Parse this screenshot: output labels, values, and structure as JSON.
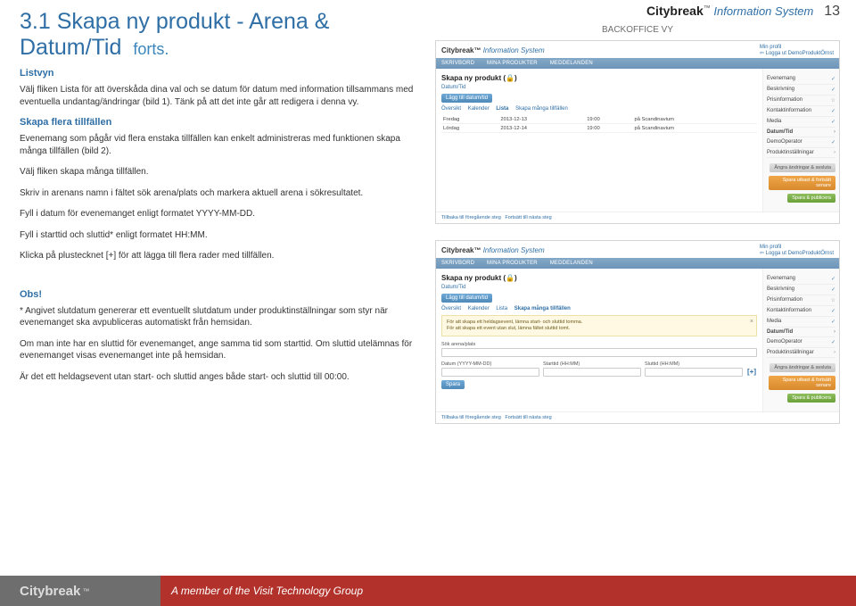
{
  "header": {
    "title": "3.1 Skapa ny produkt - Arena & Datum/Tid",
    "title_cont": "forts.",
    "brand_cb": "Citybreak",
    "brand_tm": "™",
    "brand_is": "Information System",
    "page_no": "13",
    "backoffice": "BACKOFFICE VY"
  },
  "left": {
    "sec1h": "Listvyn",
    "p1": "Välj fliken Lista för att överskåda dina val och se datum för datum med information tillsammans med eventuella undantag/ändringar (bild 1). Tänk på att det inte går att redigera i denna vy.",
    "sec2h": "Skapa flera tillfällen",
    "p2": "Evenemang som pågår vid flera enstaka tillfällen kan enkelt administreras med funktionen skapa många tillfällen (bild 2).",
    "p3": "Välj fliken skapa många tillfällen.",
    "p4": "Skriv in arenans namn i fältet sök arena/plats och markera aktuell arena i sökresultatet.",
    "p5": "Fyll i datum för evenemanget enligt formatet YYYY-MM-DD.",
    "p6": "Fyll i starttid och sluttid* enligt formatet HH:MM.",
    "p7": "Klicka på plustecknet [+] för att lägga till flera rader med tillfällen.",
    "sec3h": "Obs!",
    "p8": "* Angivet slutdatum genererar ett eventuellt slutdatum under produktinställningar som styr när evenemanget ska avpubliceras automatiskt från hemsidan.",
    "p9": "Om man inte har en sluttid för evenemanget, ange samma tid som starttid. Om sluttid utelämnas för evenemanget visas evenemanget inte på hemsidan.",
    "p10": "Är det ett heldagsevent utan start- och sluttid anges både start- och sluttid till 00:00."
  },
  "mock": {
    "brand": "Citybreak™",
    "brand_is": "Information System",
    "profile": "Min profil",
    "login": "⇦ Logga ut DemoProduktÖrnst",
    "nav": {
      "a": "SKRIVBORD",
      "b": "MINA PRODUKTER",
      "c": "MEDDELANDEN"
    },
    "title": "Skapa ny produkt (🔒)",
    "subtitle": "Datum/Tid",
    "add_btn": "Lägg till datum/tid",
    "tabs": {
      "a": "Översikt",
      "b": "Kalender",
      "c": "Lista",
      "d": "Skapa många tillfällen"
    },
    "rows": [
      {
        "day": "Fredag",
        "date": "2013-12-13",
        "time": "19:00",
        "place": "på Scandinavium"
      },
      {
        "day": "Lördag",
        "date": "2013-12-14",
        "time": "19:00",
        "place": "på Scandinavium"
      }
    ],
    "side": {
      "a": "Evenemang",
      "b": "Beskrivning",
      "c": "Prisinformation",
      "d": "Kontaktinformation",
      "e": "Media",
      "f": "Datum/Tid",
      "g": "DemoOperator",
      "h": "Produktinställningar"
    },
    "btn1": "Ångra ändringar & avsluta",
    "btn2": "Spara utkast & fortsätt senare",
    "btn3": "Spara & publicera",
    "save_btn": "Spara",
    "bottom_prev": "Tillbaka till föregående steg",
    "bottom_next": "Fortsätt till nästa steg",
    "hint_l1": "För att skapa ett heldagsevent, lämna start- och sluttid tomma.",
    "hint_l2": "För att skapa ett event utan slut, lämna fältet sluttid tomt.",
    "f_search": "Sök arena/plats",
    "f_date": "Datum (YYYY-MM-DD)",
    "f_start": "Starttid (HH:MM)",
    "f_end": "Sluttid (HH:MM)",
    "plus": "[+]"
  },
  "footer": {
    "brand": "Citybreak",
    "tm": "™",
    "member": "A member of the Visit Technology Group"
  }
}
